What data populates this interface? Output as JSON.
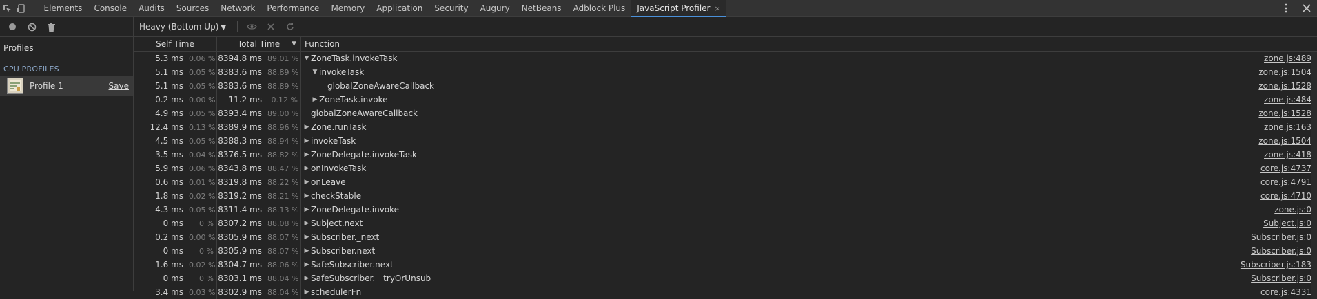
{
  "tabbar": {
    "tabs": [
      "Elements",
      "Console",
      "Audits",
      "Sources",
      "Network",
      "Performance",
      "Memory",
      "Application",
      "Security",
      "Augury",
      "NetBeans",
      "Adblock Plus",
      "JavaScript Profiler"
    ],
    "active_index": 12,
    "close_glyph": "×",
    "icons": [
      "inspect-icon",
      "device-toggle-icon"
    ],
    "right_icons": [
      "more-vertical-icon",
      "close-icon"
    ]
  },
  "sidebar": {
    "icons": [
      "record-icon",
      "clear-icon",
      "trash-icon"
    ],
    "title": "Profiles",
    "section": "CPU PROFILES",
    "profile": {
      "label": "Profile 1",
      "save": "Save"
    }
  },
  "toolbar": {
    "view_select": "Heavy (Bottom Up)",
    "icons": [
      "eye-icon",
      "exclude-icon",
      "restore-icon"
    ]
  },
  "table": {
    "headers": {
      "self": "Self Time",
      "total": "Total Time",
      "function": "Function"
    },
    "rows": [
      {
        "self": "5.3 ms",
        "self_pct": "0.06 %",
        "total": "8394.8 ms",
        "total_pct": "89.01 %",
        "indent": 0,
        "tri": "▼",
        "name": "ZoneTask.invokeTask",
        "link": "zone.js:489"
      },
      {
        "self": "5.1 ms",
        "self_pct": "0.05 %",
        "total": "8383.6 ms",
        "total_pct": "88.89 %",
        "indent": 1,
        "tri": "▼",
        "name": "invokeTask",
        "link": "zone.js:1504"
      },
      {
        "self": "5.1 ms",
        "self_pct": "0.05 %",
        "total": "8383.6 ms",
        "total_pct": "88.89 %",
        "indent": 2,
        "tri": "",
        "name": "globalZoneAwareCallback",
        "link": "zone.js:1528"
      },
      {
        "self": "0.2 ms",
        "self_pct": "0.00 %",
        "total": "11.2 ms",
        "total_pct": "0.12 %",
        "indent": 1,
        "tri": "▶",
        "name": "ZoneTask.invoke",
        "link": "zone.js:484"
      },
      {
        "self": "4.9 ms",
        "self_pct": "0.05 %",
        "total": "8393.4 ms",
        "total_pct": "89.00 %",
        "indent": 0,
        "tri": "",
        "name": "globalZoneAwareCallback",
        "link": "zone.js:1528"
      },
      {
        "self": "12.4 ms",
        "self_pct": "0.13 %",
        "total": "8389.9 ms",
        "total_pct": "88.96 %",
        "indent": 0,
        "tri": "▶",
        "name": "Zone.runTask",
        "link": "zone.js:163"
      },
      {
        "self": "4.5 ms",
        "self_pct": "0.05 %",
        "total": "8388.3 ms",
        "total_pct": "88.94 %",
        "indent": 0,
        "tri": "▶",
        "name": "invokeTask",
        "link": "zone.js:1504"
      },
      {
        "self": "3.5 ms",
        "self_pct": "0.04 %",
        "total": "8376.5 ms",
        "total_pct": "88.82 %",
        "indent": 0,
        "tri": "▶",
        "name": "ZoneDelegate.invokeTask",
        "link": "zone.js:418"
      },
      {
        "self": "5.9 ms",
        "self_pct": "0.06 %",
        "total": "8343.8 ms",
        "total_pct": "88.47 %",
        "indent": 0,
        "tri": "▶",
        "name": "onInvokeTask",
        "link": "core.js:4737"
      },
      {
        "self": "0.6 ms",
        "self_pct": "0.01 %",
        "total": "8319.8 ms",
        "total_pct": "88.22 %",
        "indent": 0,
        "tri": "▶",
        "name": "onLeave",
        "link": "core.js:4791"
      },
      {
        "self": "1.8 ms",
        "self_pct": "0.02 %",
        "total": "8319.2 ms",
        "total_pct": "88.21 %",
        "indent": 0,
        "tri": "▶",
        "name": "checkStable",
        "link": "core.js:4710"
      },
      {
        "self": "4.3 ms",
        "self_pct": "0.05 %",
        "total": "8311.4 ms",
        "total_pct": "88.13 %",
        "indent": 0,
        "tri": "▶",
        "name": "ZoneDelegate.invoke",
        "link": "zone.js:0"
      },
      {
        "self": "0 ms",
        "self_pct": "0 %",
        "total": "8307.2 ms",
        "total_pct": "88.08 %",
        "indent": 0,
        "tri": "▶",
        "name": "Subject.next",
        "link": "Subject.js:0"
      },
      {
        "self": "0.2 ms",
        "self_pct": "0.00 %",
        "total": "8305.9 ms",
        "total_pct": "88.07 %",
        "indent": 0,
        "tri": "▶",
        "name": "Subscriber._next",
        "link": "Subscriber.js:0"
      },
      {
        "self": "0 ms",
        "self_pct": "0 %",
        "total": "8305.9 ms",
        "total_pct": "88.07 %",
        "indent": 0,
        "tri": "▶",
        "name": "Subscriber.next",
        "link": "Subscriber.js:0"
      },
      {
        "self": "1.6 ms",
        "self_pct": "0.02 %",
        "total": "8304.7 ms",
        "total_pct": "88.06 %",
        "indent": 0,
        "tri": "▶",
        "name": "SafeSubscriber.next",
        "link": "Subscriber.js:183"
      },
      {
        "self": "0 ms",
        "self_pct": "0 %",
        "total": "8303.1 ms",
        "total_pct": "88.04 %",
        "indent": 0,
        "tri": "▶",
        "name": "SafeSubscriber.__tryOrUnsub",
        "link": "Subscriber.js:0"
      },
      {
        "self": "3.4 ms",
        "self_pct": "0.03 %",
        "total": "8302.9 ms",
        "total_pct": "88.04 %",
        "indent": 0,
        "tri": "▶",
        "name": "schedulerFn",
        "link": "core.js:4331"
      }
    ]
  }
}
